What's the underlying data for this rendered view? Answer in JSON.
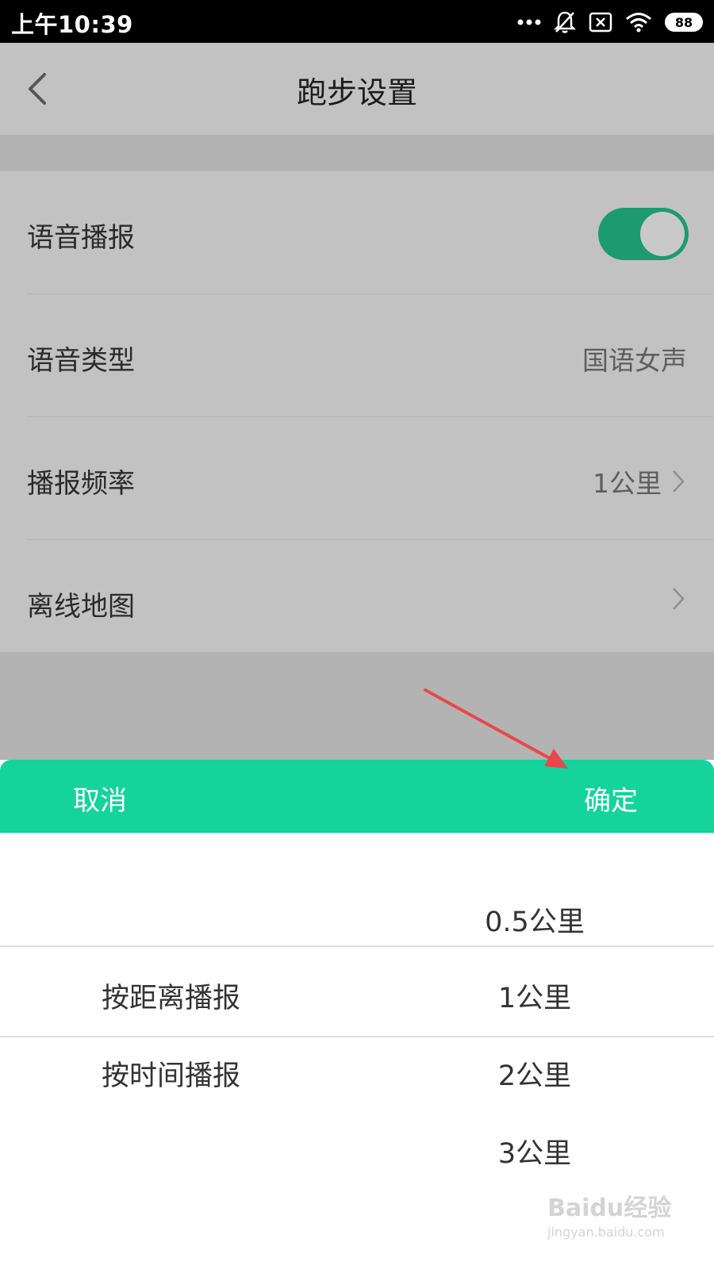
{
  "status_bar": {
    "time": "上午10:39",
    "battery": "88",
    "icons": [
      "more-dots-icon",
      "bell-muted-icon",
      "no-sim-icon",
      "wifi-icon",
      "battery-icon"
    ]
  },
  "header": {
    "title": "跑步设置",
    "back_icon": "chevron-left-icon"
  },
  "settings": {
    "voice_broadcast": {
      "label": "语音播报",
      "enabled": true
    },
    "voice_type": {
      "label": "语音类型",
      "value": "国语女声"
    },
    "frequency": {
      "label": "播报频率",
      "value": "1公里"
    },
    "offline_map": {
      "label": "离线地图"
    }
  },
  "picker": {
    "cancel_label": "取消",
    "confirm_label": "确定",
    "left_column": [
      "按距离播报",
      "按时间播报"
    ],
    "right_column": [
      "0.5公里",
      "1公里",
      "2公里",
      "3公里"
    ]
  },
  "watermark": {
    "main": "Baidu经验",
    "sub": "jingyan.baidu.com"
  },
  "colors": {
    "accent": "#14d39b",
    "toggle_on": "#1d9a70",
    "annotation_arrow": "#e8484a"
  }
}
